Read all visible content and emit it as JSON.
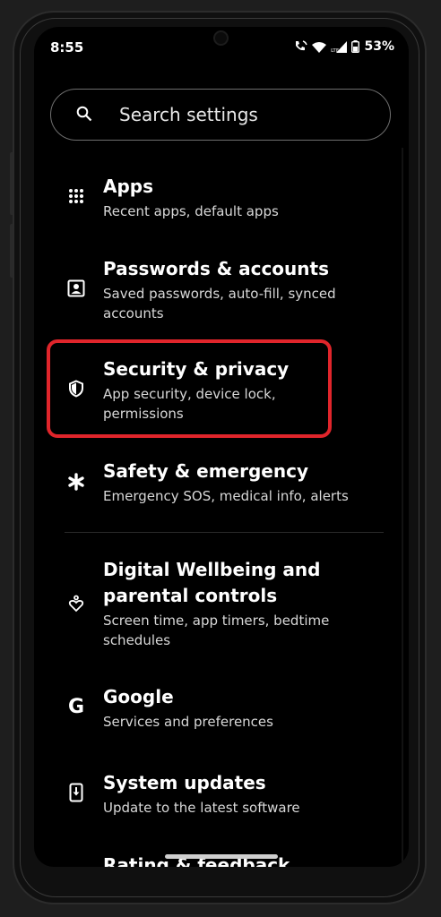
{
  "status": {
    "time": "8:55",
    "battery": "53%"
  },
  "search": {
    "placeholder": "Search settings"
  },
  "items": [
    {
      "title": "Apps",
      "sub": "Recent apps, default apps",
      "icon": "grid-icon"
    },
    {
      "title": "Passwords & accounts",
      "sub1": "Saved passwords, auto-fill, synced",
      "sub2": "accounts",
      "icon": "account-box-icon"
    },
    {
      "title": "Security & privacy",
      "sub1": "App security, device lock,",
      "sub2": "permissions",
      "icon": "shield-icon"
    },
    {
      "title": "Safety & emergency",
      "sub": "Emergency SOS, medical info, alerts",
      "icon": "asterisk-icon"
    },
    {
      "title1": "Digital Wellbeing and",
      "title2": "parental controls",
      "sub1": "Screen time, app timers, bedtime",
      "sub2": "schedules",
      "icon": "wellbeing-icon"
    },
    {
      "title": "Google",
      "sub": "Services and preferences",
      "icon": "google-g-icon"
    },
    {
      "title": "System updates",
      "sub": "Update to the latest software",
      "icon": "system-update-icon"
    },
    {
      "title": "Rating & feedback",
      "icon": "feedback-icon"
    }
  ],
  "colors": {
    "highlight": "#e0252b",
    "background": "#000000"
  }
}
